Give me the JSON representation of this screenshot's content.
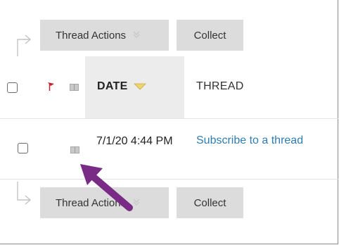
{
  "toolbar_top": {
    "thread_actions_label": "Thread Actions",
    "collect_label": "Collect"
  },
  "table": {
    "columns": {
      "date_label": "DATE",
      "thread_label": "THREAD"
    },
    "rows": [
      {
        "date": "7/1/20 4:44 PM",
        "thread": "Subscribe to a thread"
      }
    ]
  },
  "toolbar_bottom": {
    "thread_actions_label": "Thread Actions",
    "collect_label": "Collect"
  },
  "colors": {
    "link": "#2f7db3",
    "flag": "#c0202a",
    "sort_arrow": "#f0d56a",
    "annotation_arrow": "#7a2b86"
  },
  "icons": [
    "corner-arrow-icon",
    "flag-icon",
    "unread-mail-icon",
    "sort-down-icon",
    "chevron-down-icon",
    "annotation-arrow"
  ]
}
